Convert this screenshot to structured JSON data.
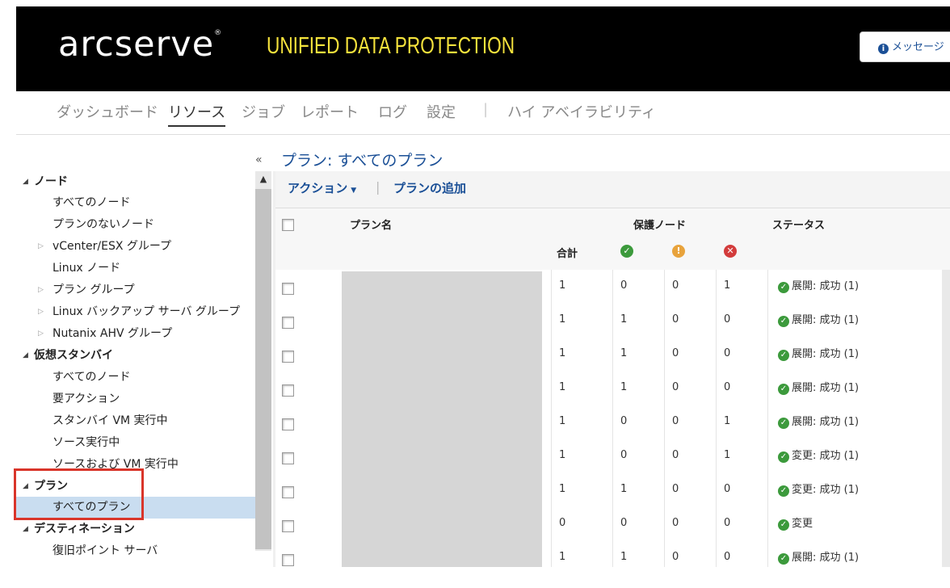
{
  "header": {
    "logo": "arcserve",
    "logo_mark": "®",
    "product": "UNIFIED DATA PROTECTION",
    "message_button": "メッセージ"
  },
  "nav": {
    "items": [
      "ダッシュボード",
      "リソース",
      "ジョブ",
      "レポート",
      "ログ",
      "設定"
    ],
    "active": "リソース",
    "separator": "|",
    "extra": "ハイ アベイラビリティ"
  },
  "sidebar": {
    "collapse_glyph": "«",
    "groups": [
      {
        "label": "ノード",
        "items": [
          "すべてのノード",
          "プランのないノード",
          "vCenter/ESX グループ",
          "Linux ノード",
          "プラン グループ",
          "Linux バックアップ サーバ グループ",
          "Nutanix AHV グループ"
        ]
      },
      {
        "label": "仮想スタンバイ",
        "items": [
          "すべてのノード",
          "要アクション",
          "スタンバイ VM 実行中",
          "ソース実行中",
          "ソースおよび VM 実行中"
        ]
      },
      {
        "label": "プラン",
        "items": [
          "すべてのプラン"
        ]
      },
      {
        "label": "デスティネーション",
        "items": [
          "復旧ポイント サーバ"
        ]
      }
    ],
    "selected": "すべてのプラン"
  },
  "main": {
    "title": "プラン: すべてのプラン",
    "toolbar": {
      "action": "アクション",
      "add_plan": "プランの追加",
      "separator": "|"
    },
    "columns": {
      "plan_name": "プラン名",
      "protected_nodes": "保護ノード",
      "status": "ステータス",
      "total": "合計"
    },
    "rows": [
      {
        "total": "1",
        "ok": "0",
        "warn": "0",
        "err": "1",
        "status": "展開: 成功 (1)"
      },
      {
        "total": "1",
        "ok": "1",
        "warn": "0",
        "err": "0",
        "status": "展開: 成功 (1)"
      },
      {
        "total": "1",
        "ok": "1",
        "warn": "0",
        "err": "0",
        "status": "展開: 成功 (1)"
      },
      {
        "total": "1",
        "ok": "1",
        "warn": "0",
        "err": "0",
        "status": "展開: 成功 (1)"
      },
      {
        "total": "1",
        "ok": "0",
        "warn": "0",
        "err": "1",
        "status": "展開: 成功 (1)"
      },
      {
        "total": "1",
        "ok": "0",
        "warn": "0",
        "err": "1",
        "status": "変更: 成功 (1)"
      },
      {
        "total": "1",
        "ok": "1",
        "warn": "0",
        "err": "0",
        "status": "変更: 成功 (1)"
      },
      {
        "total": "0",
        "ok": "0",
        "warn": "0",
        "err": "0",
        "status": "変更"
      },
      {
        "total": "1",
        "ok": "1",
        "warn": "0",
        "err": "0",
        "status": "展開: 成功 (1)"
      }
    ]
  },
  "colors": {
    "accent": "#1a4f96",
    "brand_yellow": "#f5e23c",
    "ok": "#3c9a3c",
    "warn": "#e8a33c",
    "error": "#d33c3c",
    "highlight": "#d9352a"
  }
}
